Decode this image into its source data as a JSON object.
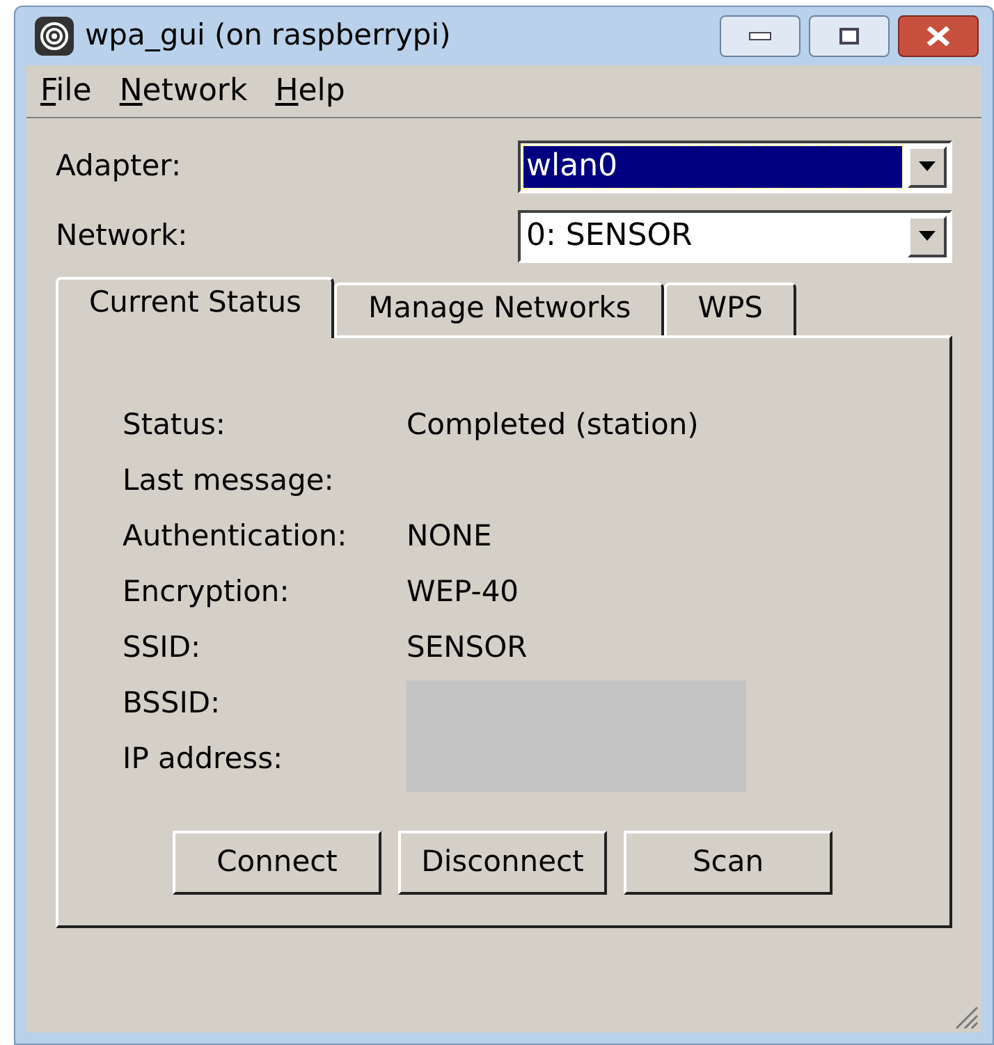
{
  "window": {
    "title": "wpa_gui (on raspberrypi)"
  },
  "menu": [
    {
      "label": "File"
    },
    {
      "label": "Network"
    },
    {
      "label": "Help"
    }
  ],
  "adapter": {
    "label": "Adapter:",
    "value": "wlan0",
    "focused": true
  },
  "network": {
    "label": "Network:",
    "value": "0: SENSOR",
    "focused": false
  },
  "tabs": [
    {
      "label": "Current Status",
      "selected": true
    },
    {
      "label": "Manage Networks",
      "selected": false
    },
    {
      "label": "WPS",
      "selected": false
    }
  ],
  "status_rows": [
    {
      "label": "Status:",
      "value": "Completed (station)",
      "kind": "text"
    },
    {
      "label": "Last message:",
      "kind": "text"
    },
    {
      "label": "Authentication:",
      "value": "NONE",
      "kind": "text"
    },
    {
      "label": "Encryption:",
      "value": "WEP-40",
      "kind": "text"
    },
    {
      "label": "SSID:",
      "value": "SENSOR",
      "kind": "text"
    },
    {
      "label": "BSSID:",
      "kind": "redacted"
    },
    {
      "label": "IP address:",
      "kind": "redacted"
    }
  ],
  "buttons": [
    "Connect",
    "Disconnect",
    "Scan"
  ]
}
